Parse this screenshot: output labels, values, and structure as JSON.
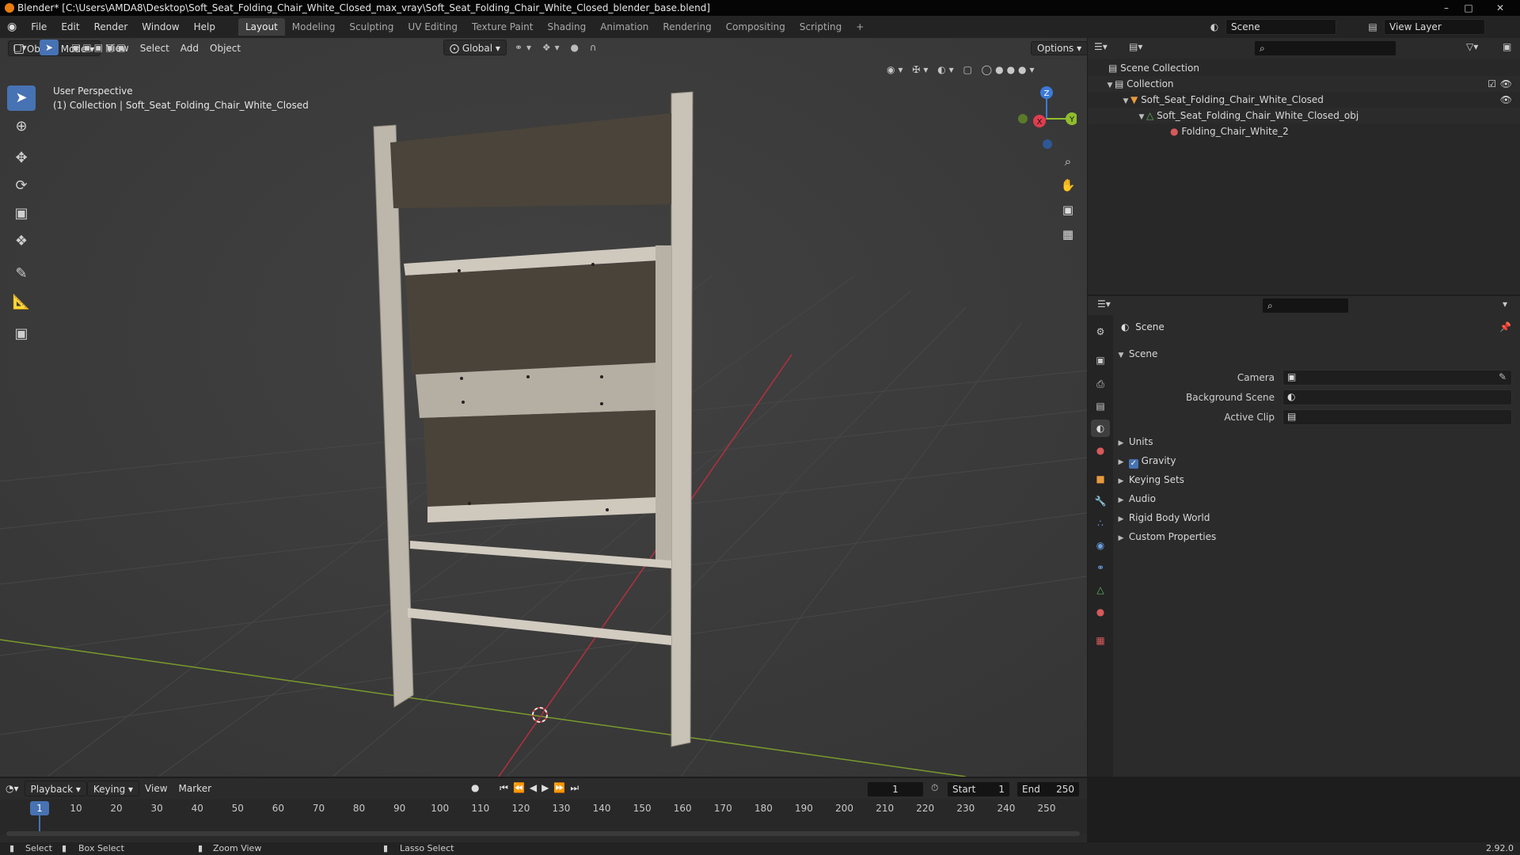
{
  "window": {
    "title": "Blender* [C:\\Users\\AMDA8\\Desktop\\Soft_Seat_Folding_Chair_White_Closed_max_vray\\Soft_Seat_Folding_Chair_White_Closed_blender_base.blend]"
  },
  "menu": [
    "File",
    "Edit",
    "Render",
    "Window",
    "Help"
  ],
  "workspaces": [
    "Layout",
    "Modeling",
    "Sculpting",
    "UV Editing",
    "Texture Paint",
    "Shading",
    "Animation",
    "Rendering",
    "Compositing",
    "Scripting"
  ],
  "workspace_add": "+",
  "scene_field": "Scene",
  "view_layer_field": "View Layer",
  "toolbar_header": {
    "orientation": "Global",
    "options": "Options"
  },
  "viewport_header": {
    "mode": "Object Mode",
    "view": "View",
    "select": "Select",
    "add": "Add",
    "object": "Object"
  },
  "viewport": {
    "perspective": "User Perspective",
    "collection_info": "(1) Collection | Soft_Seat_Folding_Chair_White_Closed"
  },
  "gizmo": {
    "z": "Z",
    "y": "Y",
    "x": "X"
  },
  "outliner": {
    "root": "Scene Collection",
    "rows": [
      {
        "label": "Collection"
      },
      {
        "label": "Soft_Seat_Folding_Chair_White_Closed"
      },
      {
        "label": "Soft_Seat_Folding_Chair_White_Closed_obj"
      },
      {
        "label": "Folding_Chair_White_2"
      }
    ]
  },
  "properties": {
    "context": "Scene",
    "panel": "Scene",
    "fields": [
      {
        "label": "Camera"
      },
      {
        "label": "Background Scene"
      },
      {
        "label": "Active Clip"
      }
    ],
    "sections": [
      "Units",
      "Gravity",
      "Keying Sets",
      "Audio",
      "Rigid Body World",
      "Custom Properties"
    ],
    "gravity_checked": true
  },
  "timeline": {
    "playback": "Playback",
    "keying": "Keying",
    "view": "View",
    "marker": "Marker",
    "current_frame": "1",
    "start_label": "Start",
    "start": "1",
    "end_label": "End",
    "end": "250",
    "ticks": [
      "1",
      "10",
      "20",
      "30",
      "40",
      "50",
      "60",
      "70",
      "80",
      "90",
      "100",
      "110",
      "120",
      "130",
      "140",
      "150",
      "160",
      "170",
      "180",
      "190",
      "200",
      "210",
      "220",
      "230",
      "240",
      "250"
    ]
  },
  "status": {
    "select": "Select",
    "box_select": "Box Select",
    "zoom_view": "Zoom View",
    "lasso_select": "Lasso Select",
    "version": "2.92.0"
  },
  "colors": {
    "accent": "#4772b3",
    "x_axis": "#e13d4f",
    "y_axis": "#8fbd2e",
    "z_axis": "#3c7ad6",
    "chair": "#bdb6ab",
    "fabric": "#4a4339"
  }
}
